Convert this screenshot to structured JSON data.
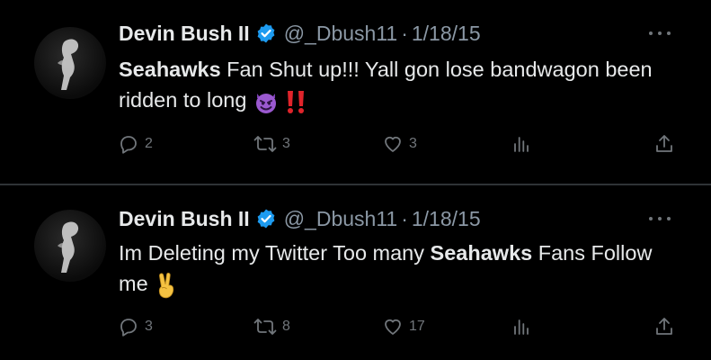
{
  "tweets": [
    {
      "name": "Devin Bush II",
      "handle": "@_Dbush11",
      "separator": "·",
      "date": "1/18/15",
      "text_bold_1": "Seahawks",
      "text_1": " Fan Shut up!!! Yall gon lose bandwagon been ridden to long ",
      "emoji_1": "smiling-imp-emoji",
      "emoji_2": "double-exclamation-emoji",
      "replies": "2",
      "retweets": "3",
      "likes": "3"
    },
    {
      "name": "Devin Bush II",
      "handle": "@_Dbush11",
      "separator": "·",
      "date": "1/18/15",
      "text_1": "Im Deleting my Twitter Too many ",
      "text_bold_1": "Seahawks",
      "text_2": " Fans Follow me ",
      "emoji_1": "victory-hand-emoji",
      "replies": "3",
      "retweets": "8",
      "likes": "17"
    }
  ],
  "colors": {
    "background": "#000000",
    "text": "#e7e9ea",
    "secondary": "#8b98a5",
    "icons": "#71767b",
    "verified": "#1d9bf0",
    "divider": "#2f3336"
  }
}
